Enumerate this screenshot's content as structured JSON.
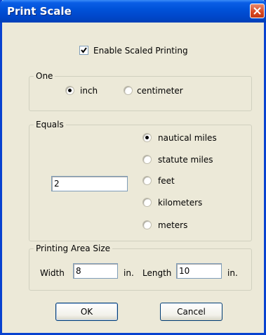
{
  "window": {
    "title": "Print Scale"
  },
  "enable_scaled_printing": {
    "label": "Enable Scaled Printing",
    "checked": true
  },
  "one_group": {
    "legend": "One",
    "options": [
      {
        "label": "inch",
        "selected": true
      },
      {
        "label": "centimeter",
        "selected": false
      }
    ]
  },
  "equals_group": {
    "legend": "Equals",
    "value": "2",
    "options": [
      {
        "label": "nautical miles",
        "selected": true
      },
      {
        "label": "statute miles",
        "selected": false
      },
      {
        "label": "feet",
        "selected": false
      },
      {
        "label": "kilometers",
        "selected": false
      },
      {
        "label": "meters",
        "selected": false
      }
    ]
  },
  "printing_area": {
    "legend": "Printing Area Size",
    "width_label": "Width",
    "width_value": "8",
    "width_unit": "in.",
    "length_label": "Length",
    "length_value": "10",
    "length_unit": "in."
  },
  "buttons": {
    "ok": "OK",
    "cancel": "Cancel"
  }
}
